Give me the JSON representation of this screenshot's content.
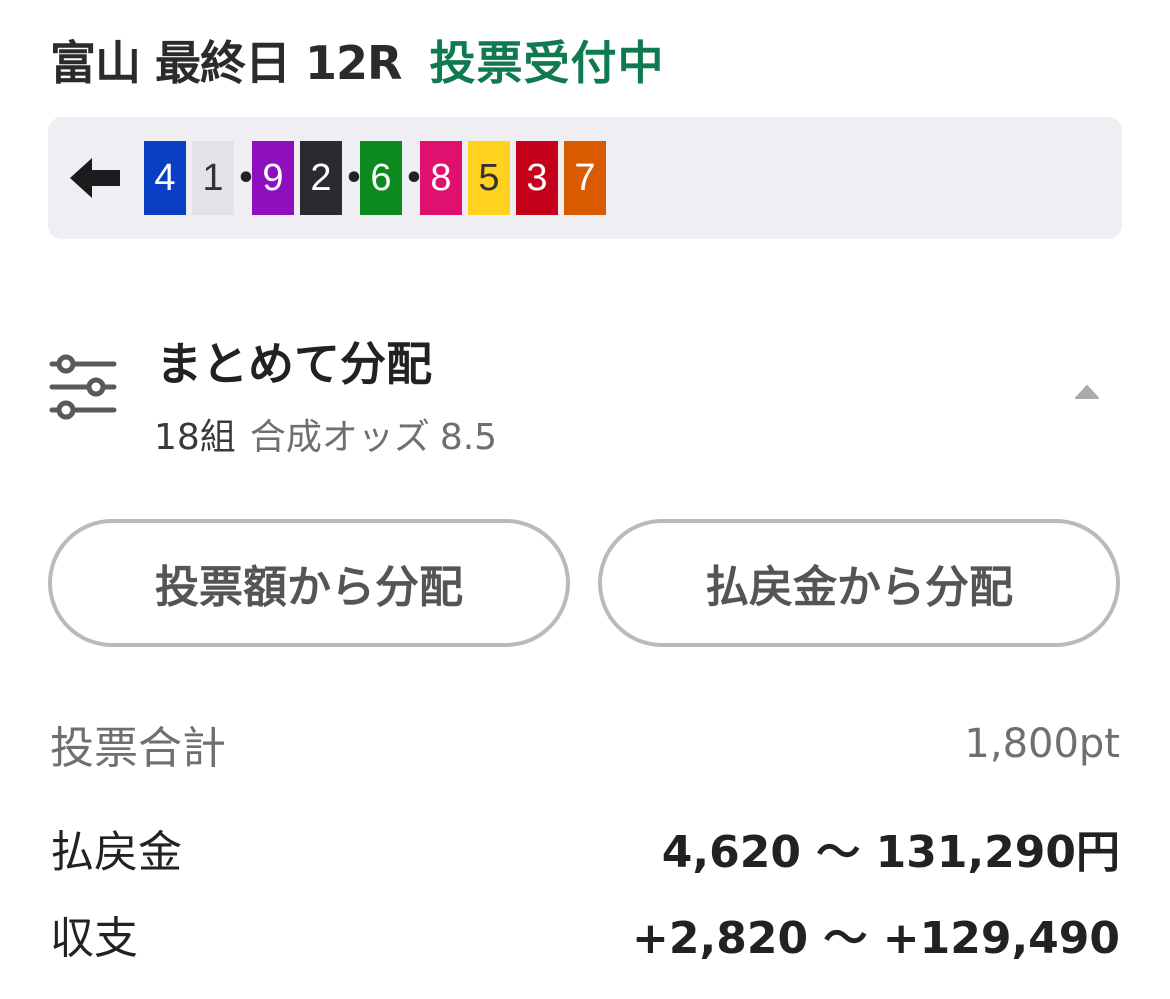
{
  "header": {
    "race_title": "富山 最終日 12R",
    "status": "投票受付中",
    "status_color": "#0f7a4f"
  },
  "picks": {
    "back_icon": "arrow-left-icon",
    "items": [
      {
        "type": "num",
        "value": "4",
        "bg": "#0a3fc4",
        "fg": "#ffffff"
      },
      {
        "type": "num",
        "value": "1",
        "bg": "#e2e2e7",
        "fg": "#333333"
      },
      {
        "type": "dot",
        "value": "•"
      },
      {
        "type": "num",
        "value": "9",
        "bg": "#8f0fbf",
        "fg": "#ffffff"
      },
      {
        "type": "num",
        "value": "2",
        "bg": "#2b2b2f",
        "fg": "#ffffff"
      },
      {
        "type": "dot",
        "value": "•"
      },
      {
        "type": "num",
        "value": "6",
        "bg": "#0c8a1d",
        "fg": "#ffffff"
      },
      {
        "type": "dot",
        "value": "•"
      },
      {
        "type": "num",
        "value": "8",
        "bg": "#e0106f",
        "fg": "#ffffff"
      },
      {
        "type": "num",
        "value": "5",
        "bg": "#ffd21f",
        "fg": "#333333"
      },
      {
        "type": "num",
        "value": "3",
        "bg": "#c4001a",
        "fg": "#ffffff"
      },
      {
        "type": "num",
        "value": "7",
        "bg": "#d95b00",
        "fg": "#ffffff"
      }
    ]
  },
  "distribution": {
    "icon": "sliders-icon",
    "title": "まとめて分配",
    "combos": "18組",
    "odds_label": "合成オッズ",
    "odds_value": "8.5",
    "caret_icon": "caret-up-icon"
  },
  "buttons": {
    "by_bet": "投票額から分配",
    "by_payout": "払戻金から分配"
  },
  "summary": {
    "total_label": "投票合計",
    "total_value": "1,800pt",
    "payout_label": "払戻金",
    "payout_value": "4,620 〜 131,290円",
    "balance_label": "収支",
    "balance_value": "+2,820 〜 +129,490"
  }
}
